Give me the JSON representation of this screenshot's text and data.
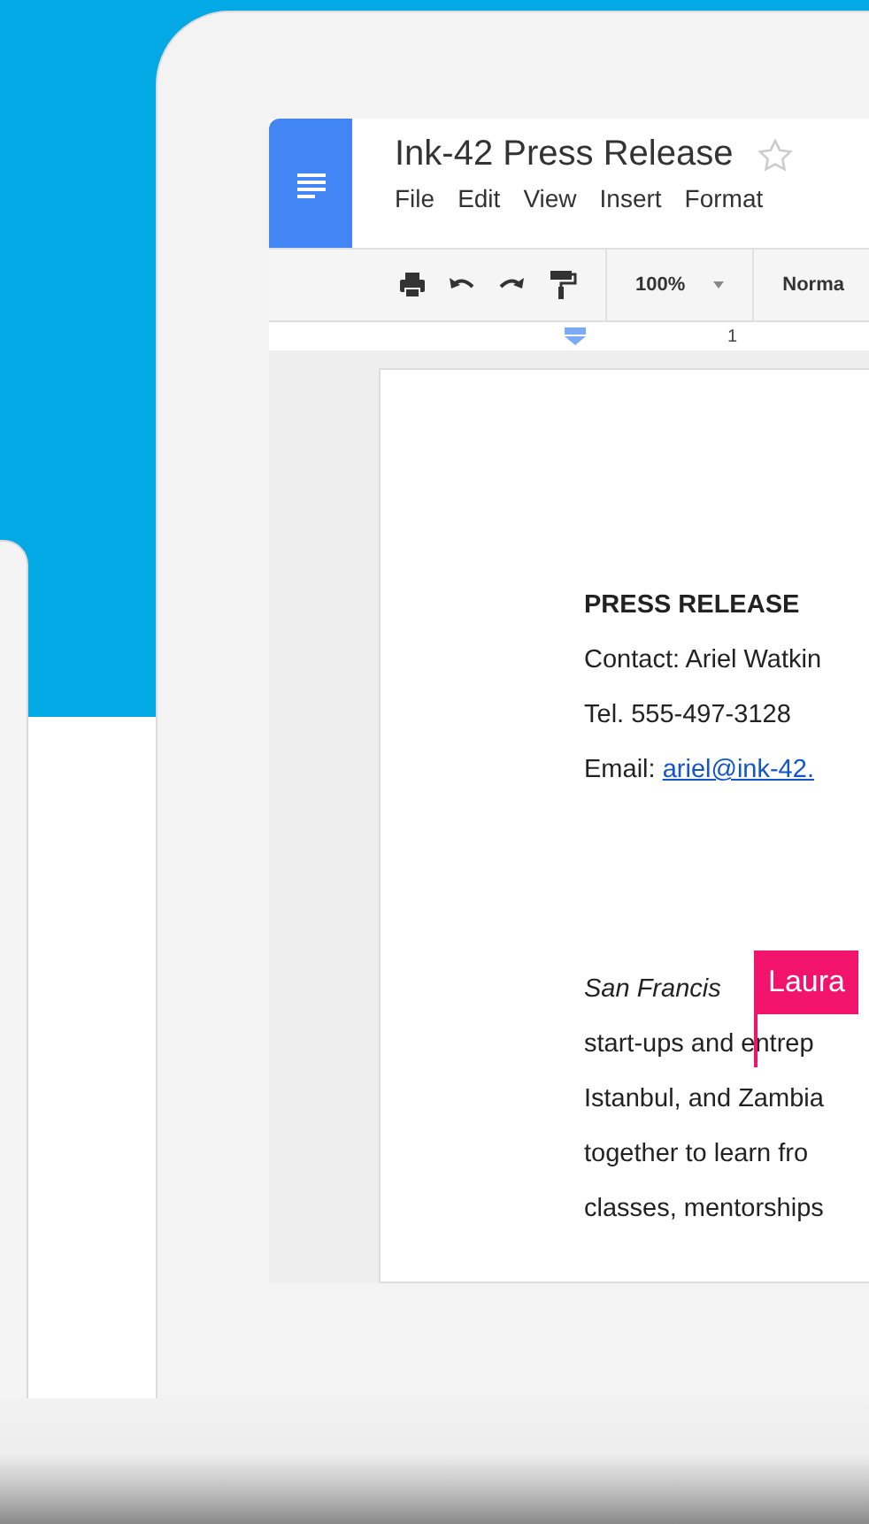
{
  "document": {
    "title": "Ink-42 Press Release"
  },
  "menu": [
    "File",
    "Edit",
    "View",
    "Insert",
    "Format"
  ],
  "toolbar": {
    "zoom": "100%",
    "style": "Norma"
  },
  "ruler": {
    "mark": "1"
  },
  "contact_lines": [
    {
      "kind": "heading",
      "text": "PRESS RELEASE"
    },
    {
      "kind": "plain",
      "text": "Contact: Ariel Watkin"
    },
    {
      "kind": "plain",
      "text": "Tel. 555-497-3128"
    },
    {
      "kind": "email",
      "text": "Email:",
      "link": "ariel@ink-42."
    }
  ],
  "body_lines": [
    {
      "kind": "italic",
      "text": "San Francis"
    },
    {
      "kind": "plain",
      "text": "start-ups and entrep"
    },
    {
      "kind": "plain",
      "text": "Istanbul, and Zambia"
    },
    {
      "kind": "plain",
      "text": "together to learn fro"
    },
    {
      "kind": "plain",
      "text": "classes, mentorships"
    }
  ],
  "collaborator": {
    "name": "Laura",
    "color": "#f2146c"
  }
}
